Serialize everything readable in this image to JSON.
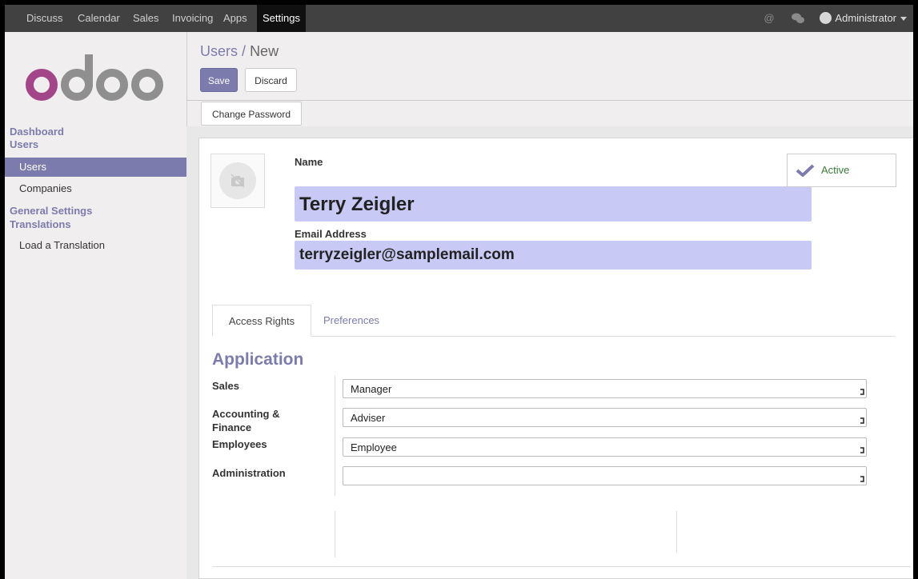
{
  "topbar": {
    "menu": [
      "Discuss",
      "Calendar",
      "Sales",
      "Invoicing",
      "Apps",
      "Settings"
    ],
    "active_menu": "Settings",
    "user": "Administrator"
  },
  "sidebar": {
    "logo_text": "odoo",
    "heads": [
      "Dashboard",
      "Users",
      "General Settings",
      "Translations"
    ],
    "items": [
      "Users",
      "Companies",
      "Load a Translation"
    ],
    "active_item": "Users"
  },
  "header": {
    "breadcrumb_parent": "Users",
    "breadcrumb_sep": "/",
    "breadcrumb_current": "New",
    "save_label": "Save",
    "discard_label": "Discard",
    "change_password_label": "Change Password"
  },
  "form": {
    "name_label": "Name",
    "name_value": "Terry Zeigler",
    "email_label": "Email Address",
    "email_value": "terryzeigler@samplemail.com",
    "active_label": "Active",
    "tabs": [
      "Access Rights",
      "Preferences"
    ],
    "section_title": "Application",
    "fields": [
      {
        "label": "Sales",
        "value": "Manager"
      },
      {
        "label": "Accounting & Finance",
        "value": "Adviser"
      },
      {
        "label": "Employees",
        "value": "Employee"
      },
      {
        "label": "Administration",
        "value": ""
      }
    ]
  },
  "colors": {
    "accent": "#7c7bad",
    "input_highlight": "#c9c9f5",
    "topbar": "#414141",
    "active_green": "#3a7c3a"
  }
}
